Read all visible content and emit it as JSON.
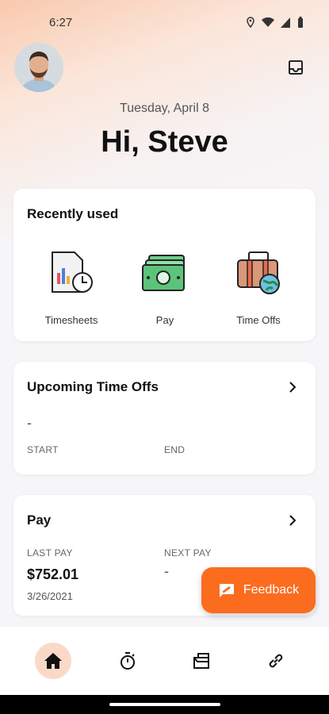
{
  "status_bar": {
    "time": "6:27",
    "icons": [
      "location-icon",
      "wifi-icon",
      "signal-icon",
      "battery-icon"
    ]
  },
  "header": {
    "date": "Tuesday, April 8",
    "greeting": "Hi, Steve"
  },
  "recently_used": {
    "title": "Recently used",
    "items": [
      {
        "label": "Timesheets",
        "icon": "timesheets-icon"
      },
      {
        "label": "Pay",
        "icon": "money-icon"
      },
      {
        "label": "Time Offs",
        "icon": "suitcase-globe-icon"
      }
    ]
  },
  "upcoming_time_offs": {
    "title": "Upcoming Time Offs",
    "value": "-",
    "start_label": "START",
    "end_label": "END"
  },
  "pay": {
    "title": "Pay",
    "last_pay_label": "LAST PAY",
    "last_pay_amount": "$752.01",
    "last_pay_date": "3/26/2021",
    "next_pay_label": "NEXT PAY",
    "next_pay_value": "-"
  },
  "feedback_button": {
    "label": "Feedback"
  },
  "bottom_nav": {
    "items": [
      "home-icon",
      "stopwatch-icon",
      "folder-icon",
      "link-icon"
    ],
    "active": "home-icon"
  },
  "colors": {
    "accent": "#fb6c1f",
    "active_nav_bg": "#fbd9c8",
    "card_bg": "#ffffff",
    "page_bg": "#f6f6f8"
  }
}
